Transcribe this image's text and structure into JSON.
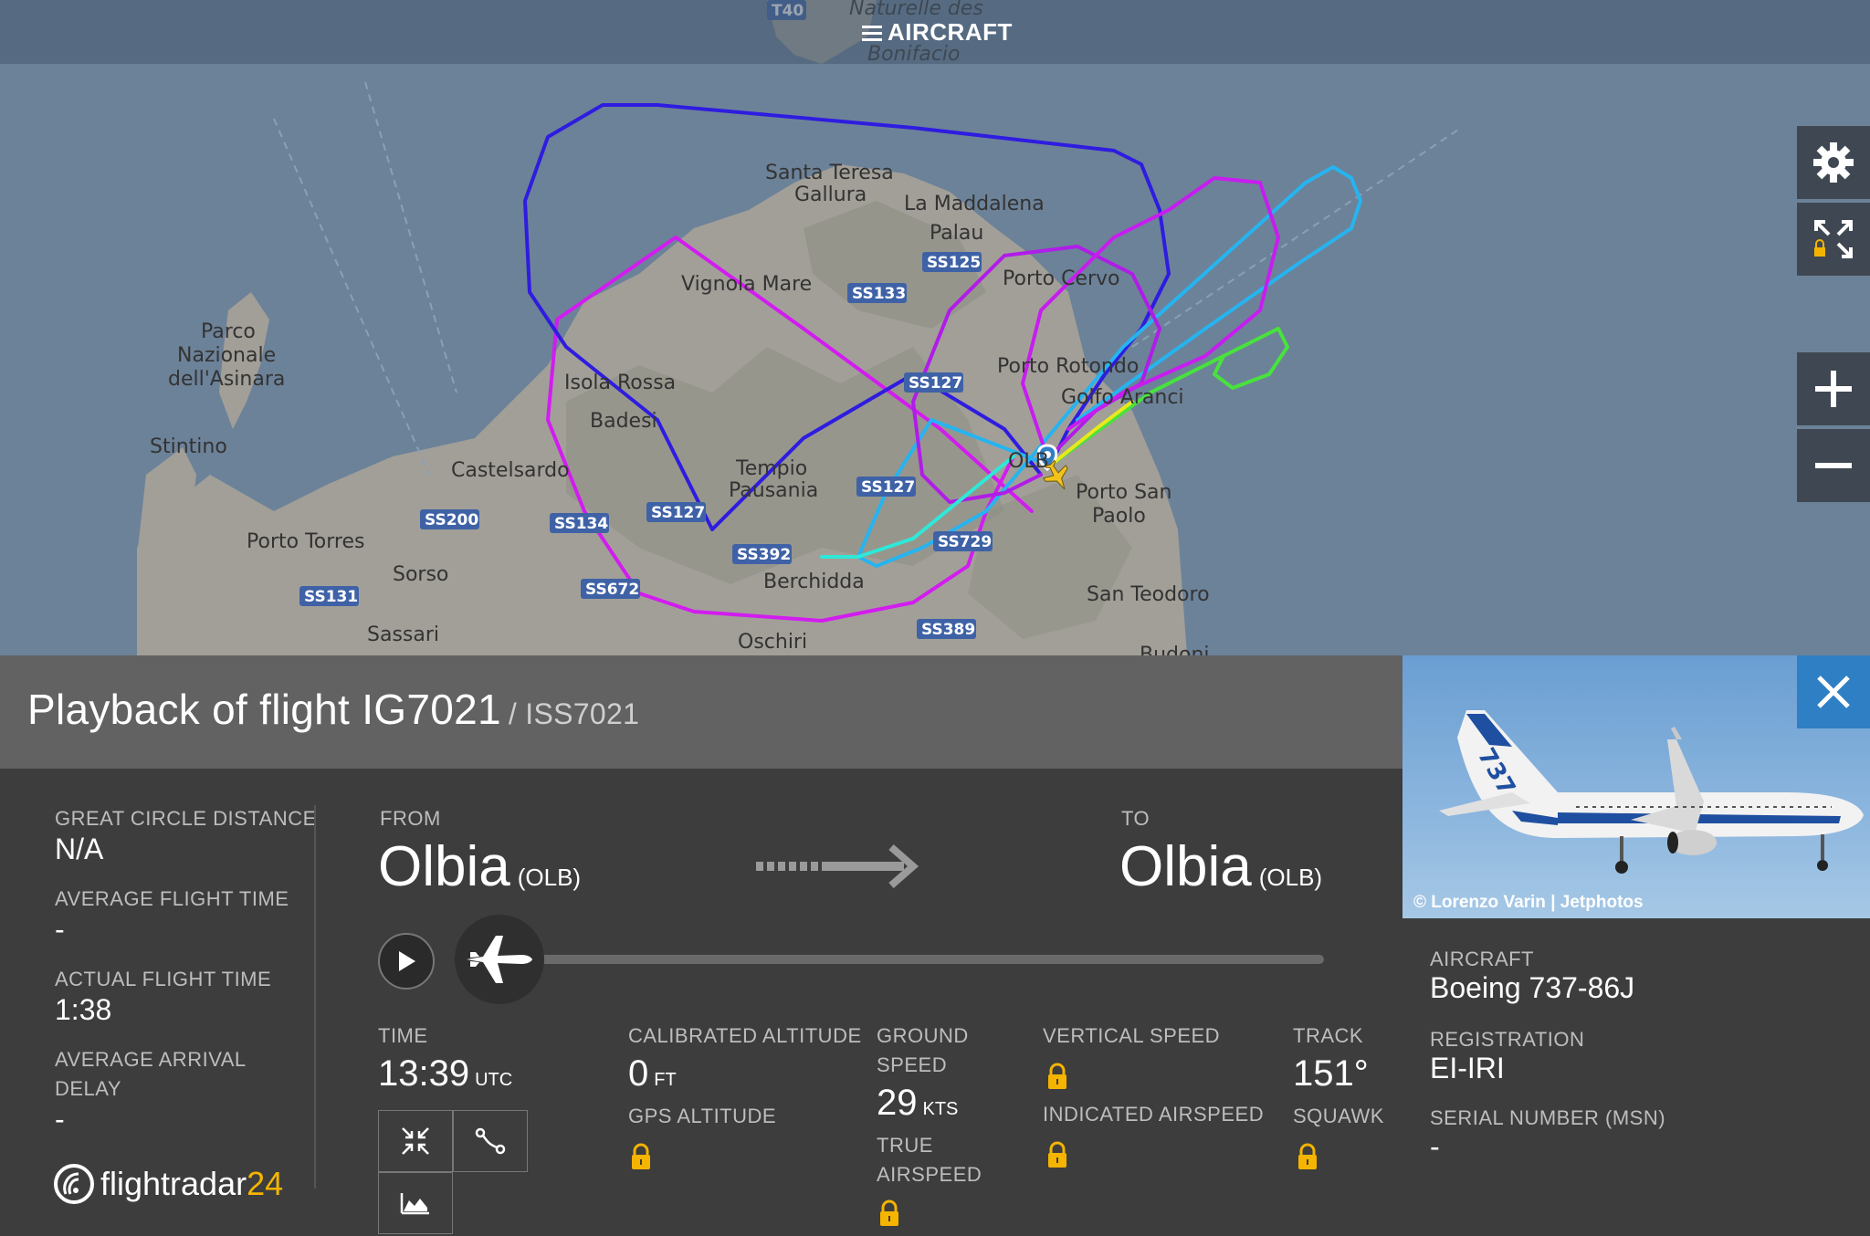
{
  "menu": {
    "label": "AIRCRAFT"
  },
  "map": {
    "places": [
      {
        "name": "Naturelle des"
      },
      {
        "name": "Bonifacio"
      },
      {
        "name": "Santa Teresa"
      },
      {
        "name": "Gallura"
      },
      {
        "name": "La Maddalena"
      },
      {
        "name": "Palau"
      },
      {
        "name": "Vignola Mare"
      },
      {
        "name": "Porto Cervo"
      },
      {
        "name": "Parco"
      },
      {
        "name": "Nazionale"
      },
      {
        "name": "dell'Asinara"
      },
      {
        "name": "Porto Rotondo"
      },
      {
        "name": "Golfo Aranci"
      },
      {
        "name": "Isola Rossa"
      },
      {
        "name": "Badesi"
      },
      {
        "name": "Stintino"
      },
      {
        "name": "Castelsardo"
      },
      {
        "name": "Tempio"
      },
      {
        "name": "Pausania"
      },
      {
        "name": "OLB"
      },
      {
        "name": "Porto San"
      },
      {
        "name": "Paolo"
      },
      {
        "name": "Porto Torres"
      },
      {
        "name": "Sorso"
      },
      {
        "name": "Berchidda"
      },
      {
        "name": "San Teodoro"
      },
      {
        "name": "Sassari"
      },
      {
        "name": "Oschiri"
      },
      {
        "name": "Budoni"
      }
    ],
    "roads": [
      "T40",
      "SS125",
      "SS133",
      "SS127",
      "SS200",
      "SS134",
      "SS127",
      "SS127",
      "SS392",
      "SS729",
      "SS131",
      "SS672",
      "SS389"
    ]
  },
  "flight": {
    "title": "Playback of flight IG7021",
    "subtitle": "/ ISS7021"
  },
  "stats": {
    "gcd_label": "GREAT CIRCLE DISTANCE",
    "gcd_value": "N/A",
    "aft_label": "AVERAGE FLIGHT TIME",
    "aft_value": "-",
    "act_label": "ACTUAL FLIGHT TIME",
    "act_value": "1:38",
    "aad_label1": "AVERAGE ARRIVAL",
    "aad_label2": "DELAY",
    "aad_value": "-"
  },
  "route": {
    "from_label": "FROM",
    "from_city": "Olbia",
    "from_code": "(OLB)",
    "to_label": "TO",
    "to_city": "Olbia",
    "to_code": "(OLB)"
  },
  "playback": {
    "progress": 0.0
  },
  "telemetry": {
    "time_label": "TIME",
    "time_value": "13:39",
    "time_unit": "UTC",
    "cal_alt_label": "CALIBRATED ALTITUDE",
    "cal_alt_value": "0",
    "cal_alt_unit": "FT",
    "gps_alt_label": "GPS ALTITUDE",
    "gs_label1": "GROUND",
    "gs_label2": "SPEED",
    "gs_value": "29",
    "gs_unit": "KTS",
    "tas_label1": "TRUE",
    "tas_label2": "AIRSPEED",
    "vs_label": "VERTICAL SPEED",
    "ias_label": "INDICATED AIRSPEED",
    "track_label": "TRACK",
    "track_value": "151°",
    "squawk_label": "SQUAWK"
  },
  "brand": {
    "name": "flightradar",
    "num": "24"
  },
  "aircraft": {
    "photo_credit": "© Lorenzo Varin | Jetphotos",
    "type_label": "AIRCRAFT",
    "type_value": "Boeing 737-86J",
    "reg_label": "REGISTRATION",
    "reg_value": "EI-IRI",
    "msn_label": "SERIAL NUMBER (MSN)",
    "msn_value": "-"
  },
  "colors": {
    "accent": "#2f7fc4",
    "lock": "#f4b400",
    "header": "#626262",
    "panel": "#3d3d3d"
  }
}
